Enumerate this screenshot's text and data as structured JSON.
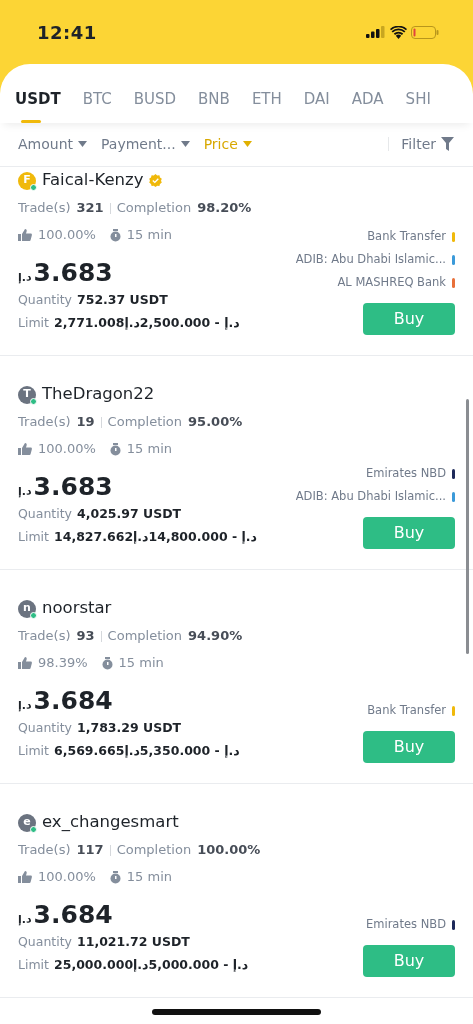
{
  "status_bar": {
    "time": "12:41"
  },
  "tabs": [
    {
      "label": "USDT",
      "selected": true
    },
    {
      "label": "BTC",
      "selected": false
    },
    {
      "label": "BUSD",
      "selected": false
    },
    {
      "label": "BNB",
      "selected": false
    },
    {
      "label": "ETH",
      "selected": false
    },
    {
      "label": "DAI",
      "selected": false
    },
    {
      "label": "ADA",
      "selected": false
    },
    {
      "label": "SHI",
      "selected": false
    }
  ],
  "filters": [
    {
      "label": "Amount",
      "selected": false
    },
    {
      "label": "Payment...",
      "selected": false
    },
    {
      "label": "Price",
      "selected": true
    }
  ],
  "filter_button": "Filter",
  "offers": [
    {
      "avatar": "F",
      "color": "#f0b90b",
      "online": true,
      "name": "Faical-Kenzy",
      "verified": true,
      "trades_label": "Trade(s)",
      "trades": "321",
      "completion_label": "Completion",
      "completion": "98.20%",
      "positive_rate": "100.00%",
      "pay_time": "15 min",
      "currency": "د.إ",
      "price": "3.683",
      "quantity_label": "Quantity",
      "quantity": "752.37 USDT",
      "limit_label": "Limit",
      "limit": "2,771.008د.إ - 2,500.000د.إ",
      "payments": [
        {
          "name": "Bank Transfer",
          "color": "#f0b90b"
        },
        {
          "name": "ADIB: Abu Dhabi Islamic...",
          "color": "#3b9ad9"
        },
        {
          "name": "AL MASHREQ Bank",
          "color": "#e8703a"
        }
      ],
      "button": "Buy"
    },
    {
      "avatar": "T",
      "color": "#6b7380",
      "online": true,
      "name": "TheDragon22",
      "verified": false,
      "trades_label": "Trade(s)",
      "trades": "19",
      "completion_label": "Completion",
      "completion": "95.00%",
      "positive_rate": "100.00%",
      "pay_time": "15 min",
      "currency": "د.إ",
      "price": "3.683",
      "quantity_label": "Quantity",
      "quantity": "4,025.97 USDT",
      "limit_label": "Limit",
      "limit": "14,827.662د.إ - 14,800.000د.إ",
      "payments": [
        {
          "name": "Emirates NBD",
          "color": "#1e2a5a"
        },
        {
          "name": "ADIB: Abu Dhabi Islamic...",
          "color": "#3b9ad9"
        }
      ],
      "button": "Buy"
    },
    {
      "avatar": "n",
      "color": "#6b7380",
      "online": true,
      "name": "noorstar",
      "verified": false,
      "trades_label": "Trade(s)",
      "trades": "93",
      "completion_label": "Completion",
      "completion": "94.90%",
      "positive_rate": "98.39%",
      "pay_time": "15 min",
      "currency": "د.إ",
      "price": "3.684",
      "quantity_label": "Quantity",
      "quantity": "1,783.29 USDT",
      "limit_label": "Limit",
      "limit": "6,569.665د.إ - 5,350.000د.إ",
      "payments": [
        {
          "name": "Bank Transfer",
          "color": "#f0b90b"
        }
      ],
      "button": "Buy"
    },
    {
      "avatar": "e",
      "color": "#6b7380",
      "online": true,
      "name": "ex_changesmart",
      "verified": false,
      "trades_label": "Trade(s)",
      "trades": "117",
      "completion_label": "Completion",
      "completion": "100.00%",
      "positive_rate": "100.00%",
      "pay_time": "15 min",
      "currency": "د.إ",
      "price": "3.684",
      "quantity_label": "Quantity",
      "quantity": "11,021.72 USDT",
      "limit_label": "Limit",
      "limit": "25,000.000د.إ - 5,000.000د.إ",
      "payments": [
        {
          "name": "Emirates NBD",
          "color": "#1e2a5a"
        }
      ],
      "button": "Buy"
    }
  ]
}
